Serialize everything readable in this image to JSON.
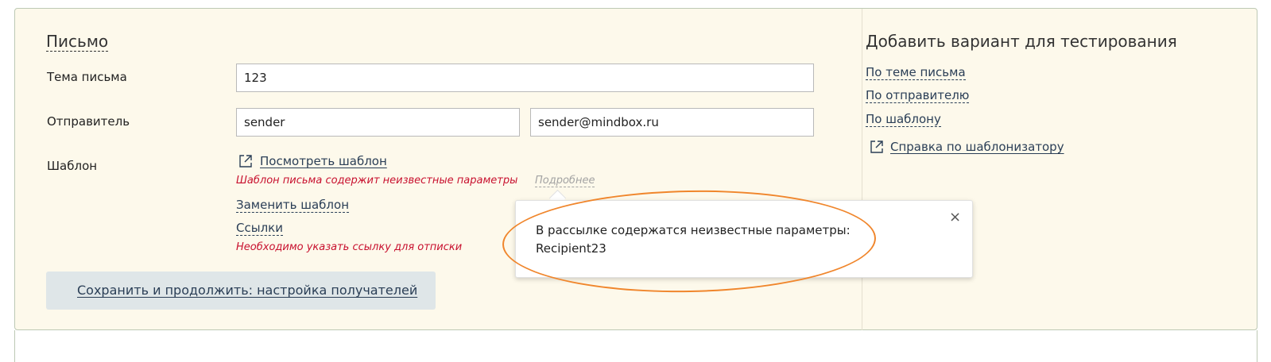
{
  "letter": {
    "title": "Письмо",
    "subject_label": "Тема письма",
    "subject_value": "123",
    "sender_label": "Отправитель",
    "sender_name": "sender",
    "sender_email": "sender@mindbox.ru",
    "template_label": "Шаблон",
    "view_template": "Посмотреть шаблон",
    "template_error": "Шаблон письма содержит неизвестные параметры",
    "details_link": "Подробнее",
    "replace_template": "Заменить шаблон",
    "links": "Ссылки",
    "links_error": "Необходимо указать ссылку для отписки",
    "save_button": "Сохранить и продолжить: настройка получателей"
  },
  "popover": {
    "line1": "В рассылке содержатся неизвестные параметры:",
    "line2": "Recipient23",
    "close_glyph": "×"
  },
  "testing": {
    "title": "Добавить вариант для тестирования",
    "items": [
      "По теме письма",
      "По отправителю",
      "По шаблону"
    ],
    "help_link": "Справка по шаблонизатору"
  },
  "colors": {
    "panel_background": "#fdf9eb",
    "panel_border": "#bdc9b4",
    "link": "#2a3e56",
    "error": "#c8102e",
    "annotation": "#f0862c",
    "button_background": "#dfe6e8"
  },
  "icons": {
    "external": "external-link-icon",
    "close": "close-icon"
  }
}
